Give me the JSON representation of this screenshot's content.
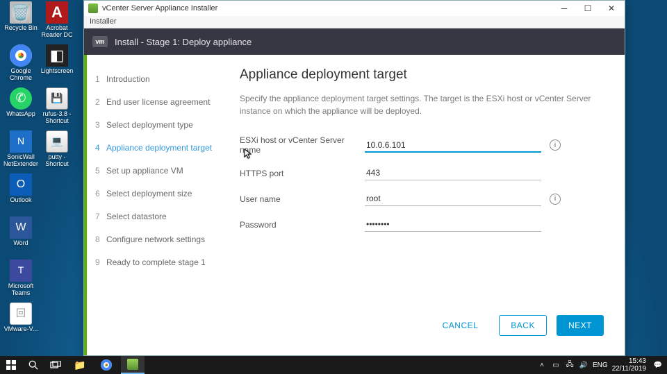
{
  "desktop_icons": {
    "recycle": "Recycle Bin",
    "acrobat": "Acrobat Reader DC",
    "chrome": "Google Chrome",
    "light": "Lightscreen",
    "whatsapp": "WhatsApp",
    "rufus": "rufus-3.8 - Shortcut",
    "sonic": "SonicWall NetExtender",
    "putty": "putty - Shortcut",
    "outlook": "Outlook",
    "word": "Word",
    "teams": "Microsoft Teams",
    "vmware": "VMware-V..."
  },
  "window": {
    "title": "vCenter Server Appliance Installer",
    "menu": "Installer",
    "vm_badge": "vm",
    "stage_title": "Install - Stage 1: Deploy appliance"
  },
  "steps": [
    {
      "n": "1",
      "label": "Introduction"
    },
    {
      "n": "2",
      "label": "End user license agreement"
    },
    {
      "n": "3",
      "label": "Select deployment type"
    },
    {
      "n": "4",
      "label": "Appliance deployment target"
    },
    {
      "n": "5",
      "label": "Set up appliance VM"
    },
    {
      "n": "6",
      "label": "Select deployment size"
    },
    {
      "n": "7",
      "label": "Select datastore"
    },
    {
      "n": "8",
      "label": "Configure network settings"
    },
    {
      "n": "9",
      "label": "Ready to complete stage 1"
    }
  ],
  "active_step_index": 3,
  "content": {
    "heading": "Appliance deployment target",
    "description": "Specify the appliance deployment target settings. The target is the ESXi host or vCenter Server instance on which the appliance will be deployed.",
    "fields": {
      "host_label": "ESXi host or vCenter Server name",
      "host_value": "10.0.6.101",
      "port_label": "HTTPS port",
      "port_value": "443",
      "user_label": "User name",
      "user_value": "root",
      "pass_label": "Password",
      "pass_value": "••••••••"
    }
  },
  "buttons": {
    "cancel": "CANCEL",
    "back": "BACK",
    "next": "NEXT"
  },
  "tray": {
    "lang": "ENG",
    "time": "15:43",
    "date": "22/11/2019"
  }
}
